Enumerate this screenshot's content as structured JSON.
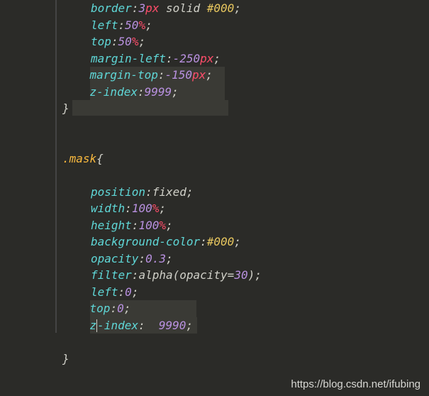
{
  "lines": [
    {
      "indent": 1,
      "parts": [
        {
          "t": "prop",
          "v": "border"
        },
        {
          "t": "colon",
          "v": ":"
        },
        {
          "t": "num",
          "v": "3"
        },
        {
          "t": "unit-px",
          "v": "px"
        },
        {
          "t": "val-plain",
          "v": " solid "
        },
        {
          "t": "hex",
          "v": "#000"
        },
        {
          "t": "semi",
          "v": ";"
        }
      ]
    },
    {
      "indent": 1,
      "parts": [
        {
          "t": "prop",
          "v": "left"
        },
        {
          "t": "colon",
          "v": ":"
        },
        {
          "t": "num",
          "v": "50"
        },
        {
          "t": "unit-pct",
          "v": "%"
        },
        {
          "t": "semi",
          "v": ";"
        }
      ]
    },
    {
      "indent": 1,
      "parts": [
        {
          "t": "prop",
          "v": "top"
        },
        {
          "t": "colon",
          "v": ":"
        },
        {
          "t": "num",
          "v": "50"
        },
        {
          "t": "unit-pct",
          "v": "%"
        },
        {
          "t": "semi",
          "v": ";"
        }
      ]
    },
    {
      "indent": 1,
      "parts": [
        {
          "t": "prop",
          "v": "margin-left"
        },
        {
          "t": "colon",
          "v": ":"
        },
        {
          "t": "num",
          "v": "-250"
        },
        {
          "t": "unit-px",
          "v": "px"
        },
        {
          "t": "semi",
          "v": ";"
        }
      ]
    },
    {
      "indent": 1,
      "parts": [
        {
          "t": "prop",
          "v": "margin-top"
        },
        {
          "t": "colon",
          "v": ":"
        },
        {
          "t": "num",
          "v": "-150"
        },
        {
          "t": "unit-px",
          "v": "px"
        },
        {
          "t": "semi",
          "v": ";"
        }
      ],
      "hl": true
    },
    {
      "indent": 1,
      "parts": [
        {
          "t": "prop",
          "v": "z-index"
        },
        {
          "t": "colon",
          "v": ":"
        },
        {
          "t": "num",
          "v": "9999"
        },
        {
          "t": "semi",
          "v": ";"
        }
      ],
      "hl": true
    },
    {
      "indent": 0,
      "parts": [
        {
          "t": "brace",
          "v": "}"
        }
      ],
      "hltail": true
    },
    {
      "blank": true
    },
    {
      "blank": true
    },
    {
      "indent": 0,
      "parts": [
        {
          "t": "selector",
          "v": ".mask"
        },
        {
          "t": "brace",
          "v": "{"
        }
      ],
      "cursor": true
    },
    {
      "blank": true
    },
    {
      "indent": 1,
      "parts": [
        {
          "t": "prop",
          "v": "position"
        },
        {
          "t": "colon",
          "v": ":"
        },
        {
          "t": "val-plain",
          "v": "fixed"
        },
        {
          "t": "semi",
          "v": ";"
        }
      ]
    },
    {
      "indent": 1,
      "parts": [
        {
          "t": "prop",
          "v": "width"
        },
        {
          "t": "colon",
          "v": ":"
        },
        {
          "t": "num",
          "v": "100"
        },
        {
          "t": "unit-pct",
          "v": "%"
        },
        {
          "t": "semi",
          "v": ";"
        }
      ]
    },
    {
      "indent": 1,
      "parts": [
        {
          "t": "prop",
          "v": "height"
        },
        {
          "t": "colon",
          "v": ":"
        },
        {
          "t": "num",
          "v": "100"
        },
        {
          "t": "unit-pct",
          "v": "%"
        },
        {
          "t": "semi",
          "v": ";"
        }
      ]
    },
    {
      "indent": 1,
      "parts": [
        {
          "t": "prop",
          "v": "background-color"
        },
        {
          "t": "colon",
          "v": ":"
        },
        {
          "t": "hex",
          "v": "#000"
        },
        {
          "t": "semi",
          "v": ";"
        }
      ]
    },
    {
      "indent": 1,
      "parts": [
        {
          "t": "prop",
          "v": "opacity"
        },
        {
          "t": "colon",
          "v": ":"
        },
        {
          "t": "num",
          "v": "0.3"
        },
        {
          "t": "semi",
          "v": ";"
        }
      ]
    },
    {
      "indent": 1,
      "parts": [
        {
          "t": "prop",
          "v": "filter"
        },
        {
          "t": "colon",
          "v": ":"
        },
        {
          "t": "func",
          "v": "alpha"
        },
        {
          "t": "func-paren",
          "v": "("
        },
        {
          "t": "val-plain",
          "v": "opacity="
        },
        {
          "t": "num",
          "v": "30"
        },
        {
          "t": "func-paren",
          "v": ")"
        },
        {
          "t": "semi",
          "v": ";"
        }
      ]
    },
    {
      "indent": 1,
      "parts": [
        {
          "t": "prop",
          "v": "left"
        },
        {
          "t": "colon",
          "v": ":"
        },
        {
          "t": "num",
          "v": "0"
        },
        {
          "t": "semi",
          "v": ";"
        }
      ]
    },
    {
      "indent": 1,
      "parts": [
        {
          "t": "prop",
          "v": "top"
        },
        {
          "t": "colon",
          "v": ":"
        },
        {
          "t": "num",
          "v": "0"
        },
        {
          "t": "semi",
          "v": ";"
        }
      ],
      "hl2": true
    },
    {
      "indent": 1,
      "parts": [
        {
          "t": "prop",
          "v": "z"
        },
        {
          "t": "cursor",
          "v": ""
        },
        {
          "t": "prop",
          "v": "-index"
        },
        {
          "t": "colon",
          "v": ": "
        },
        {
          "t": "num",
          "v": " 9990"
        },
        {
          "t": "semi",
          "v": ";"
        }
      ],
      "hl2": true
    },
    {
      "blank": true
    },
    {
      "indent": 0,
      "parts": [
        {
          "t": "brace",
          "v": "}"
        }
      ]
    }
  ],
  "watermark": "https://blog.csdn.net/ifubing"
}
